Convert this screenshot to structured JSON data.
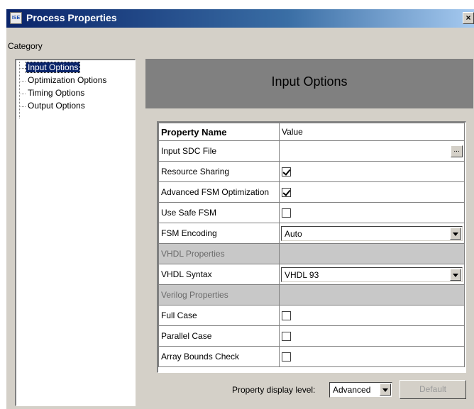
{
  "window": {
    "title": "Process Properties",
    "app_icon_text": "ISE",
    "close_glyph": "×"
  },
  "category_label": "Category",
  "tree": {
    "items": [
      {
        "label": "Input Options",
        "selected": true
      },
      {
        "label": "Optimization Options",
        "selected": false
      },
      {
        "label": "Timing Options",
        "selected": false
      },
      {
        "label": "Output Options",
        "selected": false
      }
    ]
  },
  "header": {
    "title": "Input Options"
  },
  "grid": {
    "columns": {
      "name": "Property Name",
      "value": "Value"
    },
    "rows": [
      {
        "name": "Input SDC File",
        "type": "file",
        "value": "",
        "browse_label": "..."
      },
      {
        "name": "Resource Sharing",
        "type": "checkbox",
        "checked": true
      },
      {
        "name": "Advanced FSM Optimization",
        "type": "checkbox",
        "checked": true
      },
      {
        "name": "Use Safe FSM",
        "type": "checkbox",
        "checked": false
      },
      {
        "name": "FSM Encoding",
        "type": "select",
        "value": "Auto"
      },
      {
        "name": "VHDL Properties",
        "type": "section"
      },
      {
        "name": "VHDL Syntax",
        "type": "select",
        "value": "VHDL 93"
      },
      {
        "name": "Verilog Properties",
        "type": "section"
      },
      {
        "name": "Full Case",
        "type": "checkbox",
        "checked": false
      },
      {
        "name": "Parallel Case",
        "type": "checkbox",
        "checked": false
      },
      {
        "name": "Array Bounds Check",
        "type": "checkbox",
        "checked": false
      }
    ]
  },
  "footer": {
    "display_level_label": "Property display level:",
    "display_level_value": "Advanced",
    "default_button": "Default"
  },
  "colors": {
    "selection": "#0a246a",
    "dialog_face": "#d4d0c8",
    "header_panel": "#808080",
    "section_row": "#c8c8c8"
  }
}
